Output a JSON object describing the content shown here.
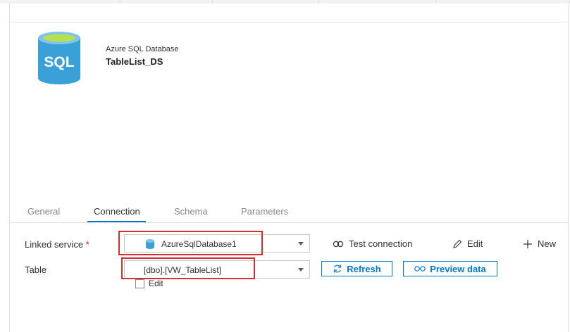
{
  "dataset": {
    "type_label": "Azure SQL Database",
    "name": "TableList_DS",
    "icon": "sql-database-icon",
    "icon_text": "SQL"
  },
  "tabs": [
    {
      "label": "General",
      "active": false
    },
    {
      "label": "Connection",
      "active": true
    },
    {
      "label": "Schema",
      "active": false
    },
    {
      "label": "Parameters",
      "active": false
    }
  ],
  "connection": {
    "linked_service": {
      "label": "Linked service",
      "required_marker": "*",
      "value": "AzureSqlDatabase1",
      "value_icon": "database-icon"
    },
    "actions": {
      "test_connection": "Test connection",
      "edit": "Edit",
      "new": "New"
    },
    "table": {
      "label": "Table",
      "value": "[dbo].[VW_TableList]",
      "refresh": "Refresh",
      "preview": "Preview data",
      "edit_checkbox": "Edit"
    }
  },
  "colors": {
    "accent": "#0078d4",
    "highlight": "#d32f2f",
    "sql_icon": "#3aa0d8"
  }
}
